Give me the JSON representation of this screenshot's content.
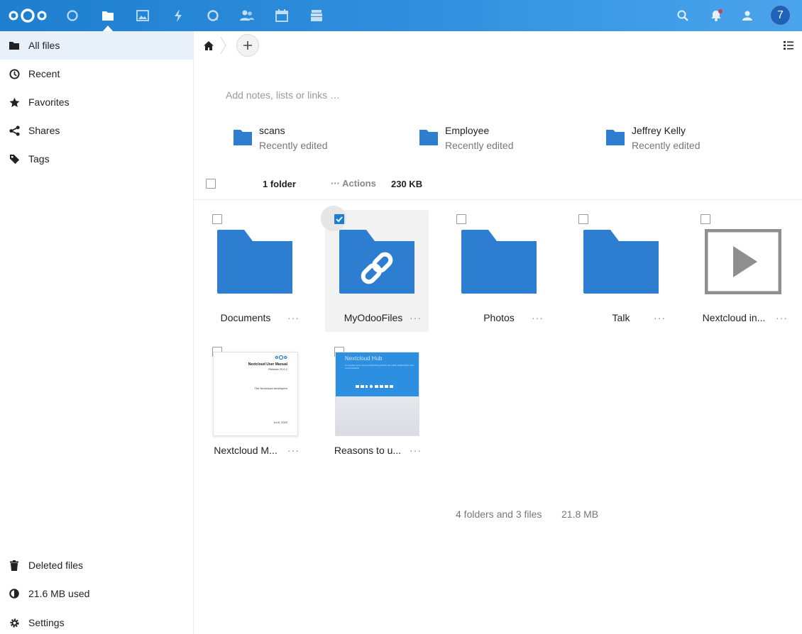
{
  "header": {
    "apps": [
      "dashboard",
      "files",
      "photos",
      "activity",
      "talk",
      "contacts",
      "calendar",
      "deck"
    ],
    "avatar_initial": "7"
  },
  "sidebar": {
    "items": [
      {
        "label": "All files",
        "icon": "folder-icon",
        "active": true
      },
      {
        "label": "Recent",
        "icon": "clock-icon"
      },
      {
        "label": "Favorites",
        "icon": "star-icon"
      },
      {
        "label": "Shares",
        "icon": "share-icon"
      },
      {
        "label": "Tags",
        "icon": "tag-icon"
      }
    ],
    "bottom": [
      {
        "label": "Deleted files",
        "icon": "trash-icon"
      },
      {
        "label": "21.6 MB used",
        "icon": "quota-icon"
      },
      {
        "label": "Settings",
        "icon": "gear-icon"
      }
    ]
  },
  "main": {
    "notes_placeholder": "Add notes, lists or links …",
    "recent": [
      {
        "name": "scans",
        "sub": "Recently edited"
      },
      {
        "name": "Employee",
        "sub": "Recently edited"
      },
      {
        "name": "Jeffrey Kelly",
        "sub": "Recently edited"
      }
    ],
    "selection": {
      "count": "1 folder",
      "actions_label": "Actions",
      "size": "230 KB"
    },
    "files": [
      {
        "name": "Documents",
        "kind": "folder"
      },
      {
        "name": "MyOdooFiles",
        "kind": "shared-folder",
        "selected": true
      },
      {
        "name": "Photos",
        "kind": "folder"
      },
      {
        "name": "Talk",
        "kind": "folder"
      },
      {
        "name": "Nextcloud in...",
        "kind": "video"
      },
      {
        "name": "Nextcloud M...",
        "kind": "pdf"
      },
      {
        "name": "Reasons to u...",
        "kind": "pdf"
      }
    ],
    "summary": {
      "count": "4 folders and 3 files",
      "size": "21.8 MB"
    },
    "pdf_manual": {
      "title": "Nextcloud User Manual",
      "release": "Release 20.0.1",
      "authors": "The Nextcloud developers",
      "date": "Jul 8, 2020"
    },
    "pdf_hub": {
      "title": "Nextcloud Hub",
      "tagline": "A complete open source productivity platform for online collaboration and communication"
    }
  },
  "colors": {
    "brand": "#1f7fcf",
    "folder": "#2d7ed0"
  }
}
